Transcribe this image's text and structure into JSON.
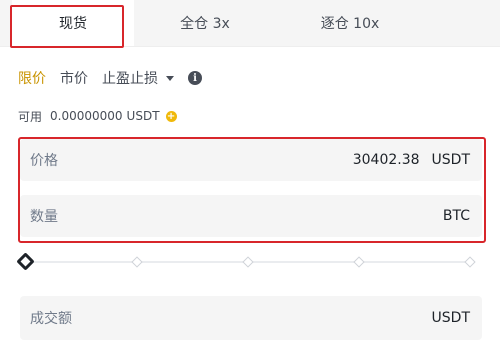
{
  "tabs": {
    "spot": "现货",
    "cross": "全仓 3x",
    "isolated": "逐仓 10x"
  },
  "order_types": {
    "limit": "限价",
    "market": "市价",
    "stop_limit": "止盈止损"
  },
  "available": {
    "label": "可用",
    "amount": "0.00000000",
    "unit": "USDT"
  },
  "price_field": {
    "label": "价格",
    "value": "30402.38",
    "unit": "USDT"
  },
  "quantity_field": {
    "label": "数量",
    "value": "",
    "unit": "BTC"
  },
  "total_field": {
    "label": "成交额",
    "value": "",
    "unit": "USDT"
  },
  "slider": {
    "percent": 0,
    "stops": [
      0,
      25,
      50,
      75,
      100
    ]
  },
  "colors": {
    "accent": "#c99400",
    "highlight": "#d8262b",
    "plus_icon": "#f0b90b"
  }
}
